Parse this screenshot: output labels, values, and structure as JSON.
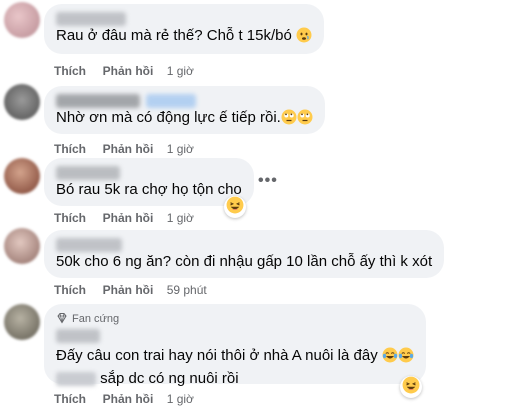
{
  "colors": {
    "bubble": "#f0f2f5",
    "meta_text": "#65676b",
    "body_text": "#050505",
    "emoji_yellow": "#ffcb4c"
  },
  "comments": [
    {
      "text": "Rau ở đâu mà rẻ thế? Chỗ t 15k/bó",
      "emojis": [
        "worried-face-emoji"
      ],
      "like_label": "Thích",
      "reply_label": "Phản hồi",
      "time": "1 giờ"
    },
    {
      "text": "Nhờ ơn mà có động lực ế tiếp rồi.",
      "emojis": [
        "rolling-eyes-emoji",
        "rolling-eyes-emoji"
      ],
      "like_label": "Thích",
      "reply_label": "Phản hồi",
      "time": "1 giờ"
    },
    {
      "text": "Bó rau 5k ra chợ họ tộn cho",
      "reaction": "laughing-emoji",
      "more": "•••",
      "like_label": "Thích",
      "reply_label": "Phản hồi",
      "time": "1 giờ"
    },
    {
      "text": "50k cho 6 ng ăn? còn đi nhậu gấp 10 lần chỗ ấy thì k xót",
      "like_label": "Thích",
      "reply_label": "Phản hồi",
      "time": "59 phút"
    },
    {
      "badge": "Fan cứng",
      "text": "Đấy câu con trai hay nói thôi ở nhà A nuôi là đây",
      "emojis": [
        "tears-of-joy-emoji",
        "tears-of-joy-emoji"
      ],
      "text2": "sắp dc có ng nuôi rồi",
      "reaction": "laughing-emoji",
      "like_label": "Thích",
      "reply_label": "Phản hồi",
      "time": "1 giờ"
    }
  ]
}
